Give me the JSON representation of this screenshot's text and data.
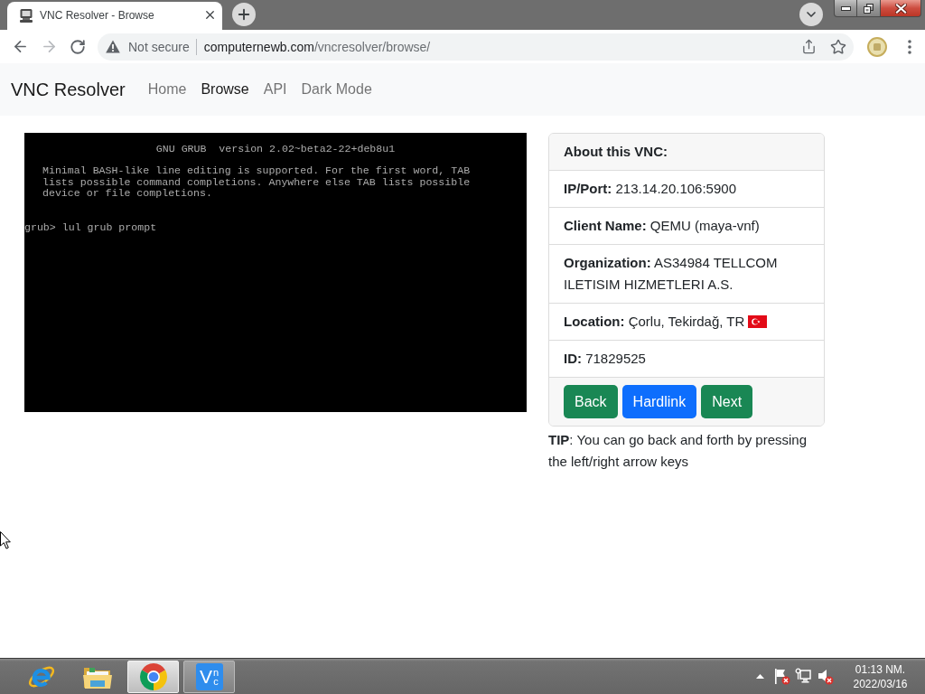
{
  "browser": {
    "tabs": [
      {
        "title": "VNC Resolver - Browse",
        "selected": true
      }
    ],
    "back_disabled": false,
    "forward_disabled": true,
    "address": {
      "security": "Not secure",
      "host": "computernewb.com",
      "path": "/vncresolver/browse/"
    }
  },
  "navbar": {
    "brand": "VNC Resolver",
    "links": [
      {
        "label": "Home",
        "selected": false
      },
      {
        "label": "Browse",
        "selected": true
      },
      {
        "label": "API",
        "selected": false
      },
      {
        "label": "Dark Mode",
        "selected": false
      }
    ]
  },
  "screen": {
    "lines": [
      {
        "kind": "title",
        "text": "GNU GRUB  version 2.02~beta2-22+deb8u1"
      },
      {
        "kind": "text",
        "text": "Minimal BASH-like line editing is supported. For the first word, TAB"
      },
      {
        "kind": "text",
        "text": "lists possible command completions. Anywhere else TAB lists possible"
      },
      {
        "kind": "text",
        "text": "device or file completions."
      },
      {
        "kind": "prompt",
        "text": "grub> lul grub prompt"
      }
    ]
  },
  "card": {
    "title": "About this VNC:",
    "rows": [
      {
        "kind": "text",
        "text": "**IP/Port:** 213.14.20.106:5900"
      },
      {
        "kind": "text",
        "text": "**Client Name:** QEMU (maya-vnf)"
      },
      {
        "kind": "text",
        "text": "**Organization:** AS34984 TELLCOM ILETISIM HIZMETLERI A.S."
      },
      {
        "kind": "flag",
        "text": "**Location:** Çorlu, Tekirdağ, TR"
      },
      {
        "kind": "text",
        "text": "**ID:** 71829525"
      }
    ],
    "buttons": [
      {
        "label": "Back",
        "color": "#198754"
      },
      {
        "label": "Hardlink",
        "color": "#0d6efd"
      },
      {
        "label": "Next",
        "color": "#198754"
      }
    ]
  },
  "tip": "**TIP**: You can go back and forth by pressing the left/right arrow keys",
  "taskbar": {
    "apps": [
      {
        "kind": "e-logo",
        "open": false,
        "selected": false
      },
      {
        "kind": "folder",
        "open": false,
        "selected": false
      },
      {
        "kind": "ring-logo",
        "open": true,
        "selected": true
      },
      {
        "kind": "tile",
        "logo": "Vnc",
        "open": true,
        "selected": false
      }
    ],
    "tray": [
      {
        "kind": "flag",
        "error": true
      },
      {
        "kind": "network",
        "error": false
      },
      {
        "kind": "speaker",
        "error": true
      }
    ],
    "clock": {
      "time": "01:13 NM.",
      "date": "2022/03/16"
    }
  }
}
